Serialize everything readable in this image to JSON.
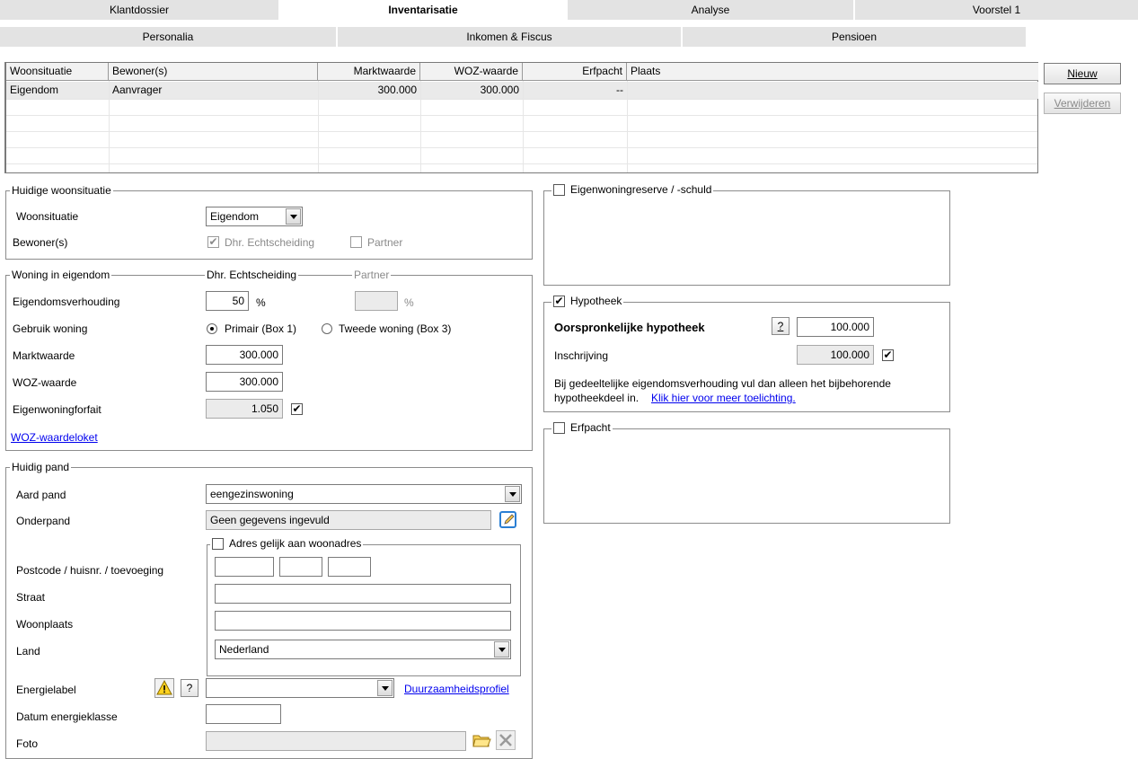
{
  "tabs": {
    "main": [
      "Klantdossier",
      "Inventarisatie",
      "Analyse",
      "Voorstel 1"
    ],
    "sub": [
      "Personalia",
      "Inkomen & Fiscus",
      "Pensioen"
    ]
  },
  "table": {
    "headers": [
      "Woonsituatie",
      "Bewoner(s)",
      "Marktwaarde",
      "WOZ-waarde",
      "Erfpacht",
      "Plaats"
    ],
    "row": [
      "Eigendom",
      "Aanvrager",
      "300.000",
      "300.000",
      "--",
      ""
    ]
  },
  "buttons": {
    "nieuw": "Nieuw",
    "verwijderen": "Verwijderen"
  },
  "huidige": {
    "legend": "Huidige woonsituatie",
    "woonsituatie_label": "Woonsituatie",
    "woonsituatie_value": "Eigendom",
    "bewoners_label": "Bewoner(s)",
    "bewoner1": "Dhr. Echtscheiding",
    "bewoner1_checked": "✔",
    "bewoner2": "Partner"
  },
  "woning": {
    "legend": "Woning in eigendom",
    "col1": "Dhr. Echtscheiding",
    "col2": "Partner",
    "eigendomsverhouding_label": "Eigendomsverhouding",
    "eigendomsverhouding_value": "50",
    "percent": "%",
    "gebruik_label": "Gebruik woning",
    "primair": "Primair  (Box 1)",
    "tweede": "Tweede woning  (Box 3)",
    "marktwaarde_label": "Marktwaarde",
    "marktwaarde_value": "300.000",
    "woz_label": "WOZ-waarde",
    "woz_value": "300.000",
    "forfait_label": "Eigenwoningforfait",
    "forfait_value": "1.050",
    "forfait_checked": "✔",
    "woz_link": "WOZ-waardeloket"
  },
  "pand": {
    "legend": "Huidig pand",
    "aard_label": "Aard pand",
    "aard_value": "eengezinswoning",
    "onderpand_label": "Onderpand",
    "onderpand_value": "Geen gegevens ingevuld",
    "adres_legend": "Adres gelijk aan woonadres",
    "postcode_label": "Postcode / huisnr. / toevoeging",
    "straat_label": "Straat",
    "woonplaats_label": "Woonplaats",
    "land_label": "Land",
    "land_value": "Nederland",
    "energie_label": "Energielabel",
    "energie_link": "Duurzaamheidsprofiel",
    "datum_label": "Datum energieklasse",
    "foto_label": "Foto",
    "question": "?"
  },
  "reserve": {
    "legend": "Eigenwoningreserve / -schuld"
  },
  "hypotheek": {
    "legend": "Hypotheek",
    "checked": "✔",
    "oorspronkelijk_label": "Oorspronkelijke hypotheek",
    "oorspronkelijk_value": "100.000",
    "inschrijving_label": "Inschrijving",
    "inschrijving_value": "100.000",
    "inschrijving_checked": "✔",
    "info_text_1": "Bij gedeeltelijke eigendomsverhouding vul dan alleen het bijbehorende",
    "info_text_2": "hypotheekdeel in.",
    "info_link": "Klik hier voor meer toelichting.",
    "question": "?"
  },
  "erfpacht": {
    "legend": "Erfpacht"
  }
}
